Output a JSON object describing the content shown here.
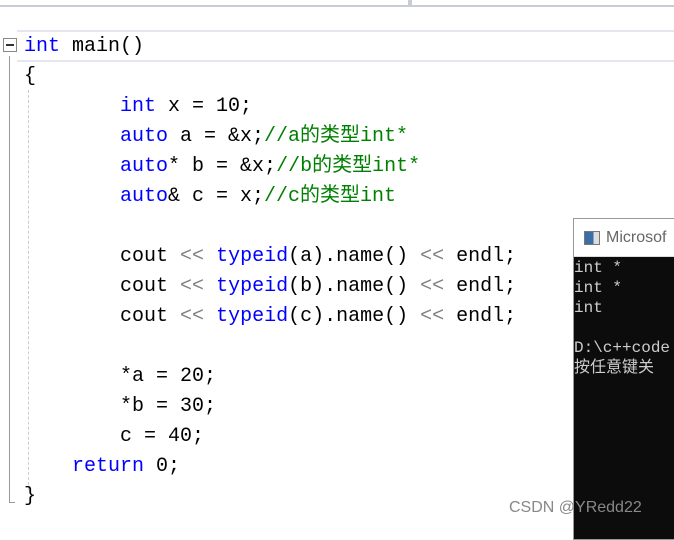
{
  "code_lines": [
    [
      {
        "t": "int",
        "c": "kw"
      },
      {
        "t": " main()",
        "c": ""
      }
    ],
    [
      {
        "t": "{",
        "c": ""
      }
    ],
    [
      {
        "t": "        ",
        "c": ""
      },
      {
        "t": "int",
        "c": "kw"
      },
      {
        "t": " x = 10;",
        "c": ""
      }
    ],
    [
      {
        "t": "        ",
        "c": ""
      },
      {
        "t": "auto",
        "c": "kw"
      },
      {
        "t": " a = &x;",
        "c": ""
      },
      {
        "t": "//a的类型int*",
        "c": "cm"
      }
    ],
    [
      {
        "t": "        ",
        "c": ""
      },
      {
        "t": "auto",
        "c": "kw"
      },
      {
        "t": "* b = &x;",
        "c": ""
      },
      {
        "t": "//b的类型int*",
        "c": "cm"
      }
    ],
    [
      {
        "t": "        ",
        "c": ""
      },
      {
        "t": "auto",
        "c": "kw"
      },
      {
        "t": "& c = x;",
        "c": ""
      },
      {
        "t": "//c的类型int",
        "c": "cm"
      }
    ],
    [
      {
        "t": "",
        "c": ""
      }
    ],
    [
      {
        "t": "        cout ",
        "c": ""
      },
      {
        "t": "<<",
        "c": "op"
      },
      {
        "t": " ",
        "c": ""
      },
      {
        "t": "typeid",
        "c": "kw"
      },
      {
        "t": "(a).name() ",
        "c": ""
      },
      {
        "t": "<<",
        "c": "op"
      },
      {
        "t": " endl;",
        "c": ""
      }
    ],
    [
      {
        "t": "        cout ",
        "c": ""
      },
      {
        "t": "<<",
        "c": "op"
      },
      {
        "t": " ",
        "c": ""
      },
      {
        "t": "typeid",
        "c": "kw"
      },
      {
        "t": "(b).name() ",
        "c": ""
      },
      {
        "t": "<<",
        "c": "op"
      },
      {
        "t": " endl;",
        "c": ""
      }
    ],
    [
      {
        "t": "        cout ",
        "c": ""
      },
      {
        "t": "<<",
        "c": "op"
      },
      {
        "t": " ",
        "c": ""
      },
      {
        "t": "typeid",
        "c": "kw"
      },
      {
        "t": "(c).name() ",
        "c": ""
      },
      {
        "t": "<<",
        "c": "op"
      },
      {
        "t": " endl;",
        "c": ""
      }
    ],
    [
      {
        "t": "",
        "c": ""
      }
    ],
    [
      {
        "t": "        *a = 20;",
        "c": ""
      }
    ],
    [
      {
        "t": "        *b = 30;",
        "c": ""
      }
    ],
    [
      {
        "t": "        c = 40;",
        "c": ""
      }
    ],
    [
      {
        "t": "    ",
        "c": ""
      },
      {
        "t": "return",
        "c": "kw"
      },
      {
        "t": " 0;",
        "c": ""
      }
    ],
    [
      {
        "t": "}",
        "c": ""
      }
    ]
  ],
  "console": {
    "title": "Microsof",
    "lines": [
      "int *",
      "int *",
      "int",
      "",
      "D:\\c++code",
      "按任意键关"
    ]
  },
  "watermark": "CSDN @YRedd22"
}
